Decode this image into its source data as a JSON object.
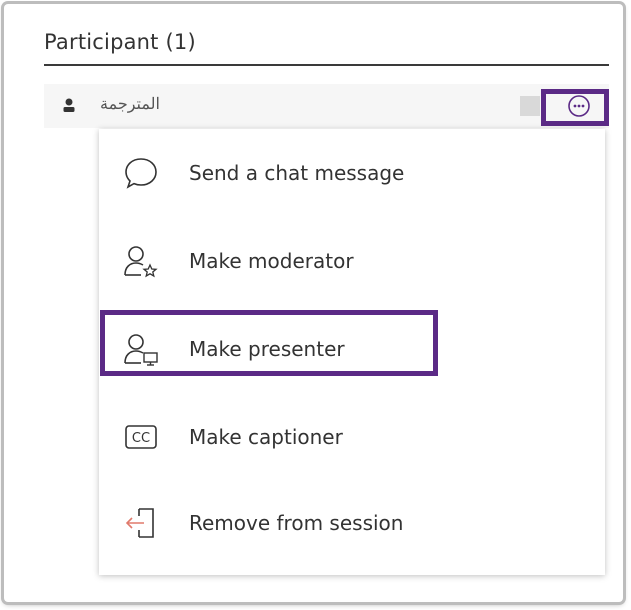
{
  "panel": {
    "title": "Participant (1)"
  },
  "participant": {
    "name": "المترجمة",
    "icon": "person-icon"
  },
  "more_button": {
    "icon": "more-options-icon",
    "highlight_color": "#5b2a86"
  },
  "menu": {
    "items": [
      {
        "label": "Send a chat message",
        "icon": "chat-bubble-icon"
      },
      {
        "label": "Make moderator",
        "icon": "user-star-icon"
      },
      {
        "label": "Make presenter",
        "icon": "user-screen-icon"
      },
      {
        "label": "Make captioner",
        "icon": "closed-caption-icon"
      },
      {
        "label": "Remove from session",
        "icon": "remove-exit-icon"
      }
    ]
  },
  "colors": {
    "accent": "#5b2a86",
    "remove_arrow": "#e07a6c"
  }
}
